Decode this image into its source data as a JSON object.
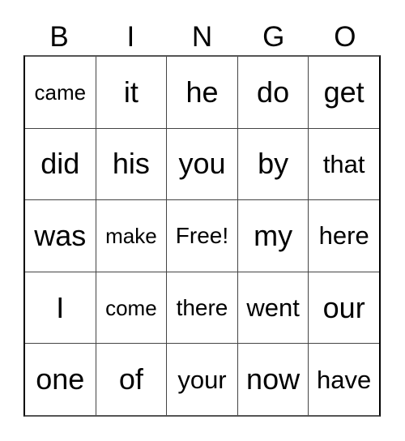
{
  "card": {
    "title": "Bingo",
    "header": {
      "letters": [
        "B",
        "I",
        "N",
        "G",
        "O"
      ]
    },
    "colors": {
      "background": "#ffffff",
      "text": "#000000",
      "grid_line": "#444444",
      "grid_outer_border": "#000000"
    },
    "grid": {
      "columns": 5,
      "rows": 5,
      "free_space_label": "Free!",
      "free_space_position": {
        "row": 3,
        "column": 3
      },
      "cells": [
        [
          {
            "text": "came",
            "shrink": true
          },
          {
            "text": "it",
            "shrink": false
          },
          {
            "text": "he",
            "shrink": false
          },
          {
            "text": "do",
            "shrink": false
          },
          {
            "text": "get",
            "shrink": false
          }
        ],
        [
          {
            "text": "did",
            "shrink": false
          },
          {
            "text": "his",
            "shrink": false
          },
          {
            "text": "you",
            "shrink": false
          },
          {
            "text": "by",
            "shrink": false
          },
          {
            "text": "that",
            "shrink": false
          }
        ],
        [
          {
            "text": "was",
            "shrink": false
          },
          {
            "text": "make",
            "shrink": true
          },
          {
            "text": "Free!",
            "shrink": false
          },
          {
            "text": "my",
            "shrink": false
          },
          {
            "text": "here",
            "shrink": false
          }
        ],
        [
          {
            "text": "I",
            "shrink": false
          },
          {
            "text": "come",
            "shrink": true
          },
          {
            "text": "there",
            "shrink": false
          },
          {
            "text": "went",
            "shrink": false
          },
          {
            "text": "our",
            "shrink": false
          }
        ],
        [
          {
            "text": "one",
            "shrink": false
          },
          {
            "text": "of",
            "shrink": false
          },
          {
            "text": "your",
            "shrink": false
          },
          {
            "text": "now",
            "shrink": false
          },
          {
            "text": "have",
            "shrink": false
          }
        ]
      ]
    }
  }
}
